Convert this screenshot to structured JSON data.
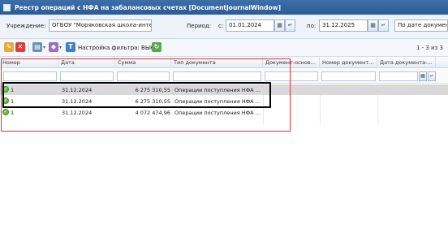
{
  "window": {
    "title": "Реестр операций с НФА на забалансовых счетах [DocumentJournalWindow]"
  },
  "filters": {
    "institution_label": "Учреждение:",
    "institution_value": "ОГБОУ \"Моряковская школа-инте",
    "period_label": "Период:",
    "from_label": "с:",
    "from_value": "01.01.2024",
    "to_label": "по:",
    "to_value": "31.12.2025",
    "sort_value": "По дате документ"
  },
  "toolbar": {
    "filter_setting_label": "Настройка фильтра: ВЫКЛ",
    "pager": "1 - 3 из 3"
  },
  "columns": [
    "Номер",
    "Дата",
    "Сумма",
    "Тип документа",
    "Документ-основ...",
    "Номер документ...",
    "Дата документа-..."
  ],
  "rows": [
    {
      "number": "1",
      "date": "31.12.2024",
      "sum": "6 275 310,55",
      "type": "Операции поступления НФА ...",
      "selected": true
    },
    {
      "number": "1",
      "date": "31.12.2024",
      "sum": "6 275 310,55",
      "type": "Операции поступления НФА ...",
      "selected": false
    },
    {
      "number": "1",
      "date": "31.12.2024",
      "sum": "4 072 474,96",
      "type": "Операции поступления НФА ...",
      "selected": false
    }
  ],
  "colors": {
    "titlebar": "#2d5a93",
    "selected_row": "#d9d9d9",
    "highlight_red": "#d9343a",
    "highlight_black": "#000000"
  }
}
